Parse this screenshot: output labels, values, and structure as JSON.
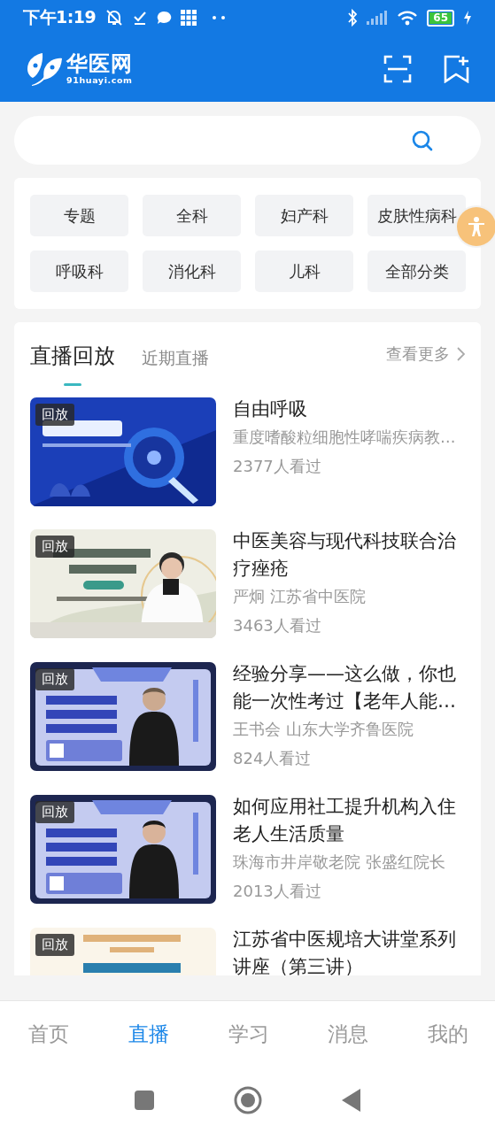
{
  "status_bar": {
    "time": "下午1:19",
    "battery": "65"
  },
  "header": {
    "logo_text": "华医网",
    "logo_subtext": "91huayi.com"
  },
  "categories": [
    "专题",
    "全科",
    "妇产科",
    "皮肤性病科",
    "呼吸科",
    "消化科",
    "儿科",
    "全部分类"
  ],
  "live": {
    "tabs": [
      {
        "label": "直播回放",
        "selected": true
      },
      {
        "label": "近期直播",
        "selected": false
      }
    ],
    "more": "查看更多",
    "items": [
      {
        "badge": "回放",
        "title": "自由呼吸",
        "subtitle": "重度嗜酸粒细胞性哮喘疾病教…",
        "views": "2377人看过"
      },
      {
        "badge": "回放",
        "title": "中医美容与现代科技联合治疗痤疮",
        "subtitle": "严炯  江苏省中医院",
        "views": "3463人看过"
      },
      {
        "badge": "回放",
        "title": "经验分享——这么做，你也能一次性考过【老年人能…",
        "subtitle": "王书会  山东大学齐鲁医院",
        "views": "824人看过"
      },
      {
        "badge": "回放",
        "title": "如何应用社工提升机构入住老人生活质量",
        "subtitle": "珠海市井岸敬老院  张盛红院长",
        "views": "2013人看过"
      },
      {
        "badge": "回放",
        "title": "江苏省中医规培大讲堂系列讲座（第三讲）"
      }
    ]
  },
  "bottom_nav": [
    {
      "label": "首页",
      "selected": false
    },
    {
      "label": "直播",
      "selected": true
    },
    {
      "label": "学习",
      "selected": false
    },
    {
      "label": "消息",
      "selected": false
    },
    {
      "label": "我的",
      "selected": false
    }
  ]
}
